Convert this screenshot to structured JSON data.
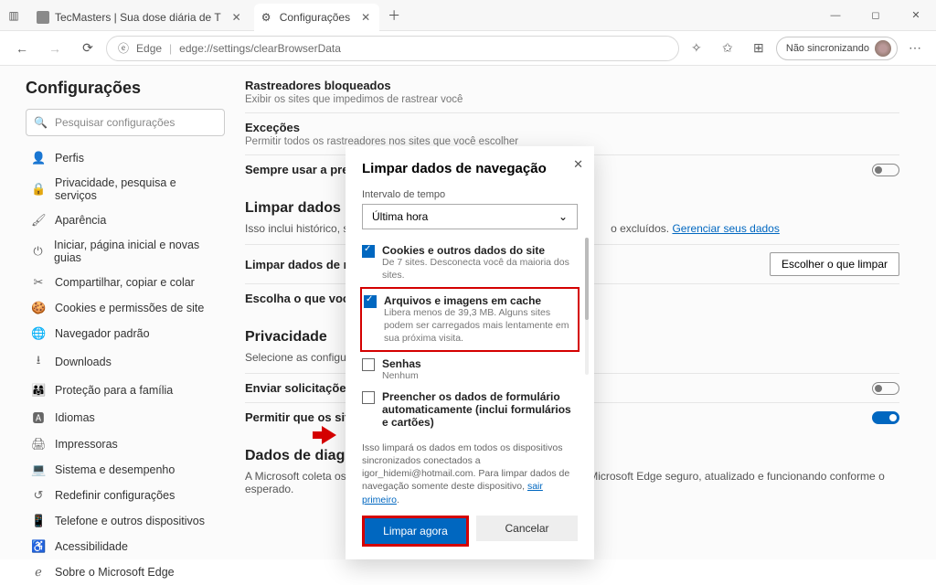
{
  "titlebar": {
    "tab1": "TecMasters | Sua dose diária de T",
    "tab2": "Configurações"
  },
  "toolbar": {
    "brand": "Edge",
    "url": "edge://settings/clearBrowserData",
    "sync": "Não sincronizando"
  },
  "sidebar": {
    "title": "Configurações",
    "search_placeholder": "Pesquisar configurações",
    "items": [
      {
        "icon": "👤",
        "label": "Perfis"
      },
      {
        "icon": "🔒",
        "label": "Privacidade, pesquisa e serviços"
      },
      {
        "icon": "🖌",
        "label": "Aparência"
      },
      {
        "icon": "⏻",
        "label": "Iniciar, página inicial e novas guias"
      },
      {
        "icon": "✂",
        "label": "Compartilhar, copiar e colar"
      },
      {
        "icon": "🍪",
        "label": "Cookies e permissões de site"
      },
      {
        "icon": "🌐",
        "label": "Navegador padrão"
      },
      {
        "icon": "⭳",
        "label": "Downloads"
      },
      {
        "icon": "👨‍👩‍👧",
        "label": "Proteção para a família"
      },
      {
        "icon": "🅰",
        "label": "Idiomas"
      },
      {
        "icon": "🖨",
        "label": "Impressoras"
      },
      {
        "icon": "💻",
        "label": "Sistema e desempenho"
      },
      {
        "icon": "↺",
        "label": "Redefinir configurações"
      },
      {
        "icon": "📱",
        "label": "Telefone e outros dispositivos"
      },
      {
        "icon": "♿",
        "label": "Acessibilidade"
      },
      {
        "icon": "ℯ",
        "label": "Sobre o Microsoft Edge"
      }
    ]
  },
  "content": {
    "trackers_title": "Rastreadores bloqueados",
    "trackers_sub": "Exibir os sites que impedimos de rastrear você",
    "exceptions_title": "Exceções",
    "exceptions_sub": "Permitir todos os rastreadores nos sites que você escolher",
    "strict_label": "Sempre usar a pre",
    "clear_heading": "Limpar dados",
    "clear_desc_a": "Isso inclui histórico, s",
    "clear_desc_b": "o excluídos.",
    "manage_link": "Gerenciar seus dados",
    "clear_row": "Limpar dados de n",
    "choose_btn": "Escolher o que limpar",
    "clear_close_row": "Escolha o que voc",
    "privacy_heading": "Privacidade",
    "privacy_sub": "Selecione as configuraç",
    "dnt_row": "Enviar solicitaçõe",
    "allow_row": "Permitir que os sit",
    "diag_heading": "Dados de diagnóstico obrigatórios",
    "diag_text": "A Microsoft coleta os dados de diagnóstico necessários para manter o Microsoft Edge seguro, atualizado e funcionando conforme o esperado."
  },
  "dialog": {
    "title": "Limpar dados de navegação",
    "range_label": "Intervalo de tempo",
    "range_value": "Última hora",
    "item_cookies_title": "Cookies e outros dados do site",
    "item_cookies_sub": "De 7 sites. Desconecta você da maioria dos sites.",
    "item_cache_title": "Arquivos e imagens em cache",
    "item_cache_sub": "Libera menos de 39,3 MB. Alguns sites podem ser carregados mais lentamente em sua próxima visita.",
    "item_pw_title": "Senhas",
    "item_pw_sub": "Nenhum",
    "item_autofill_title": "Preencher os dados de formulário automaticamente (inclui formulários e cartões)",
    "note_a": "Isso limpará os dados em todos os dispositivos sincronizados conectados a igor_hidemi@hotmail.com. Para limpar dados de navegação somente deste dispositivo, ",
    "note_link": "sair primeiro",
    "btn_primary": "Limpar agora",
    "btn_cancel": "Cancelar"
  }
}
